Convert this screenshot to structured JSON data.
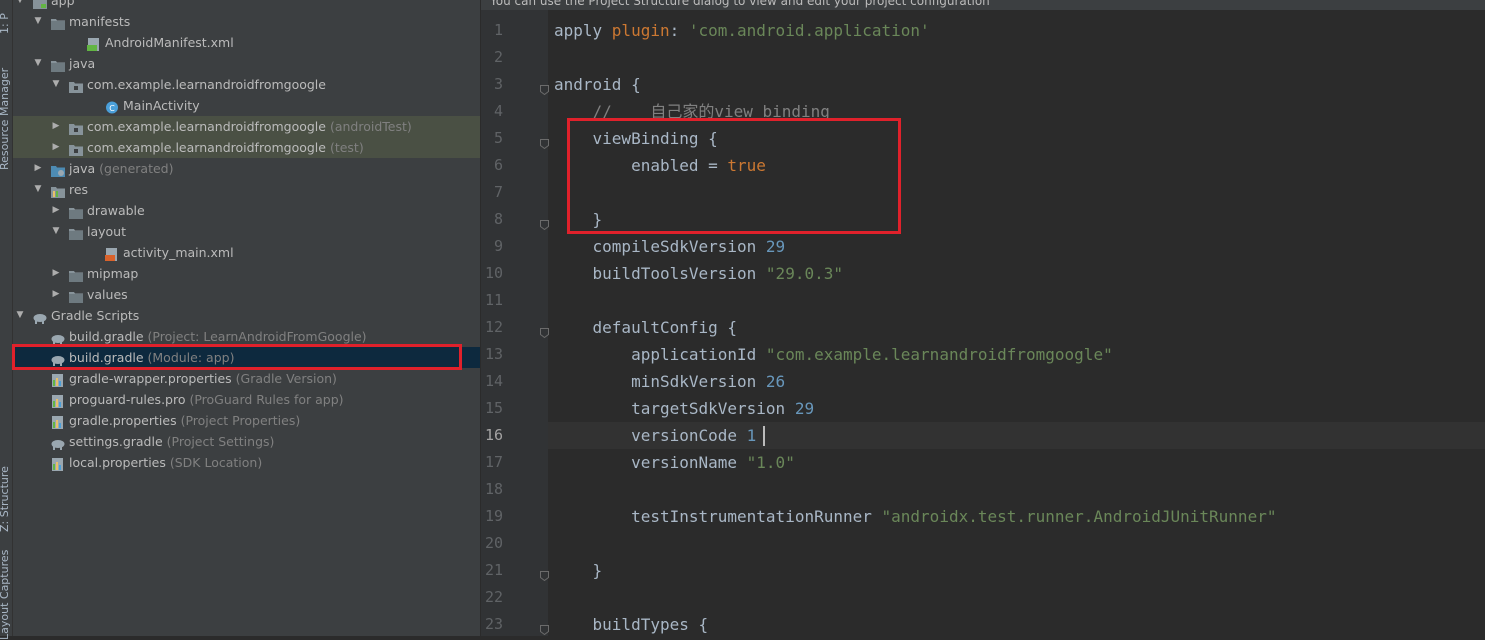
{
  "sidebar_stripe": {
    "labels": [
      "1: P",
      "Resource Manager",
      "Z: Structure",
      "Layout Captures"
    ]
  },
  "project_tree": {
    "rows": [
      {
        "label": "app",
        "hint": "",
        "icon": "module-icon",
        "arrow": "down",
        "depth": 0
      },
      {
        "label": "manifests",
        "hint": "",
        "icon": "folder-icon",
        "arrow": "down",
        "depth": 1
      },
      {
        "label": "AndroidManifest.xml",
        "hint": "",
        "icon": "manifest-file-icon",
        "arrow": "",
        "depth": 3
      },
      {
        "label": "java",
        "hint": "",
        "icon": "folder-icon",
        "arrow": "down",
        "depth": 1
      },
      {
        "label": "com.example.learnandroidfromgoogle",
        "hint": "",
        "icon": "package-icon",
        "arrow": "down",
        "depth": 2
      },
      {
        "label": "MainActivity",
        "hint": "",
        "icon": "java-class-icon",
        "arrow": "",
        "depth": 4
      },
      {
        "label": "com.example.learnandroidfromgoogle",
        "hint": "(androidTest)",
        "icon": "package-icon",
        "arrow": "right",
        "depth": 2
      },
      {
        "label": "com.example.learnandroidfromgoogle",
        "hint": "(test)",
        "icon": "package-icon",
        "arrow": "right",
        "depth": 2
      },
      {
        "label": "java",
        "hint": "(generated)",
        "icon": "generated-folder-icon",
        "arrow": "right",
        "depth": 1
      },
      {
        "label": "res",
        "hint": "",
        "icon": "res-folder-icon",
        "arrow": "down",
        "depth": 1
      },
      {
        "label": "drawable",
        "hint": "",
        "icon": "folder-icon",
        "arrow": "right",
        "depth": 2
      },
      {
        "label": "layout",
        "hint": "",
        "icon": "folder-icon",
        "arrow": "down",
        "depth": 2
      },
      {
        "label": "activity_main.xml",
        "hint": "",
        "icon": "layout-file-icon",
        "arrow": "",
        "depth": 4
      },
      {
        "label": "mipmap",
        "hint": "",
        "icon": "folder-icon",
        "arrow": "right",
        "depth": 2
      },
      {
        "label": "values",
        "hint": "",
        "icon": "folder-icon",
        "arrow": "right",
        "depth": 2
      },
      {
        "label": "Gradle Scripts",
        "hint": "",
        "icon": "gradle-icon",
        "arrow": "down",
        "depth": 0
      },
      {
        "label": "build.gradle",
        "hint": "(Project: LearnAndroidFromGoogle)",
        "icon": "gradle-icon",
        "arrow": "",
        "depth": 1
      },
      {
        "label": "build.gradle",
        "hint": "(Module: app)",
        "icon": "gradle-icon",
        "arrow": "",
        "depth": 1
      },
      {
        "label": "gradle-wrapper.properties",
        "hint": "(Gradle Version)",
        "icon": "properties-file-icon",
        "arrow": "",
        "depth": 1
      },
      {
        "label": "proguard-rules.pro",
        "hint": "(ProGuard Rules for app)",
        "icon": "properties-file-icon",
        "arrow": "",
        "depth": 1
      },
      {
        "label": "gradle.properties",
        "hint": "(Project Properties)",
        "icon": "properties-file-icon",
        "arrow": "",
        "depth": 1
      },
      {
        "label": "settings.gradle",
        "hint": "(Project Settings)",
        "icon": "gradle-icon",
        "arrow": "",
        "depth": 1
      },
      {
        "label": "local.properties",
        "hint": "(SDK Location)",
        "icon": "properties-file-icon",
        "arrow": "",
        "depth": 1
      }
    ],
    "selected_label": "build.gradle (Module: app)",
    "highlighted_label": "build.gradle (Module: app)"
  },
  "editor": {
    "banner": "You can use the Project Structure dialog to view and edit your project configuration",
    "current_line": 16,
    "lines": [
      {
        "n": "1",
        "tokens": [
          {
            "t": "apply ",
            "c": "p"
          },
          {
            "t": "plugin",
            "c": "k"
          },
          {
            "t": ": ",
            "c": "p"
          },
          {
            "t": "'com.android.application'",
            "c": "s"
          }
        ]
      },
      {
        "n": "2",
        "tokens": []
      },
      {
        "n": "3",
        "tokens": [
          {
            "t": "android {",
            "c": "p"
          }
        ]
      },
      {
        "n": "4",
        "tokens": [
          {
            "t": "    //    自己家的view binding",
            "c": "c"
          }
        ]
      },
      {
        "n": "5",
        "tokens": [
          {
            "t": "    viewBinding {",
            "c": "p"
          }
        ]
      },
      {
        "n": "6",
        "tokens": [
          {
            "t": "        enabled = ",
            "c": "p"
          },
          {
            "t": "true",
            "c": "k"
          }
        ]
      },
      {
        "n": "7",
        "tokens": []
      },
      {
        "n": "8",
        "tokens": [
          {
            "t": "    }",
            "c": "p"
          }
        ]
      },
      {
        "n": "9",
        "tokens": [
          {
            "t": "    compileSdkVersion ",
            "c": "p"
          },
          {
            "t": "29",
            "c": "n"
          }
        ]
      },
      {
        "n": "10",
        "tokens": [
          {
            "t": "    buildToolsVersion ",
            "c": "p"
          },
          {
            "t": "\"29.0.3\"",
            "c": "s"
          }
        ]
      },
      {
        "n": "11",
        "tokens": []
      },
      {
        "n": "12",
        "tokens": [
          {
            "t": "    defaultConfig {",
            "c": "p"
          }
        ]
      },
      {
        "n": "13",
        "tokens": [
          {
            "t": "        applicationId ",
            "c": "p"
          },
          {
            "t": "\"com.example.learnandroidfromgoogle\"",
            "c": "s"
          }
        ]
      },
      {
        "n": "14",
        "tokens": [
          {
            "t": "        minSdkVersion ",
            "c": "p"
          },
          {
            "t": "26",
            "c": "n"
          }
        ]
      },
      {
        "n": "15",
        "tokens": [
          {
            "t": "        targetSdkVersion ",
            "c": "p"
          },
          {
            "t": "29",
            "c": "n"
          }
        ]
      },
      {
        "n": "16",
        "tokens": [
          {
            "t": "        versionCode ",
            "c": "p"
          },
          {
            "t": "1",
            "c": "n"
          }
        ]
      },
      {
        "n": "17",
        "tokens": [
          {
            "t": "        versionName ",
            "c": "p"
          },
          {
            "t": "\"1.0\"",
            "c": "s"
          }
        ]
      },
      {
        "n": "18",
        "tokens": []
      },
      {
        "n": "19",
        "tokens": [
          {
            "t": "        testInstrumentationRunner ",
            "c": "p"
          },
          {
            "t": "\"androidx.test.runner.AndroidJUnitRunner\"",
            "c": "s"
          }
        ]
      },
      {
        "n": "20",
        "tokens": []
      },
      {
        "n": "21",
        "tokens": [
          {
            "t": "    }",
            "c": "p"
          }
        ]
      },
      {
        "n": "22",
        "tokens": []
      },
      {
        "n": "23",
        "tokens": [
          {
            "t": "    buildTypes {",
            "c": "p"
          }
        ]
      }
    ]
  },
  "colors": {
    "highlight_box": "#e0212b",
    "selection": "#0d293e",
    "vcs_added": "#4a5044",
    "keyword": "#cc7832",
    "string": "#6a8759",
    "number": "#6897bb",
    "comment": "#808080"
  }
}
